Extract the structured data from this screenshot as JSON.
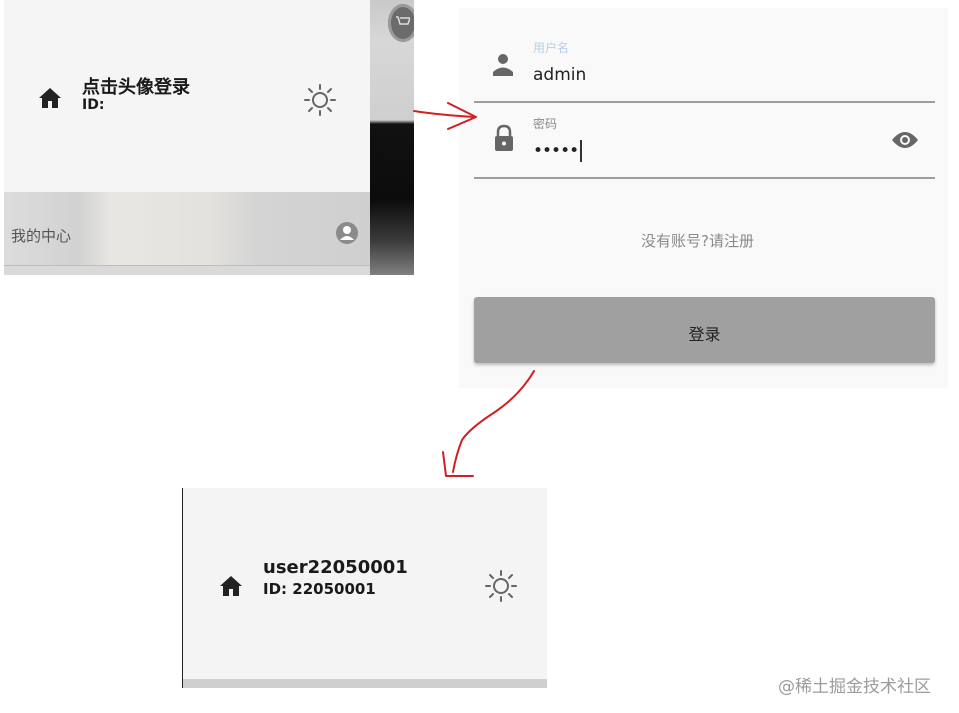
{
  "drawer_before": {
    "title": "点击头像登录",
    "id_label": "ID:",
    "menu_item_label": "我的中心",
    "icons": [
      "home-icon",
      "sun-icon",
      "avatar-icon",
      "cart-icon"
    ]
  },
  "login_form": {
    "username_label": "用户名",
    "username_value": "admin",
    "password_label": "密码",
    "password_value": "•••••",
    "register_link": "没有账号?请注册",
    "login_button": "登录",
    "colors": {
      "focused_label": "#b9cfe8",
      "label": "#8a8a8a",
      "button": "#a0a0a0"
    },
    "icons": [
      "person-icon",
      "lock-icon",
      "eye-icon"
    ]
  },
  "drawer_after": {
    "title": "user22050001",
    "id_label": "ID: 22050001",
    "icons": [
      "home-icon",
      "sun-icon"
    ]
  },
  "annotation": {
    "arrow_color": "#d02020"
  },
  "watermark": "@稀土掘金技术社区"
}
